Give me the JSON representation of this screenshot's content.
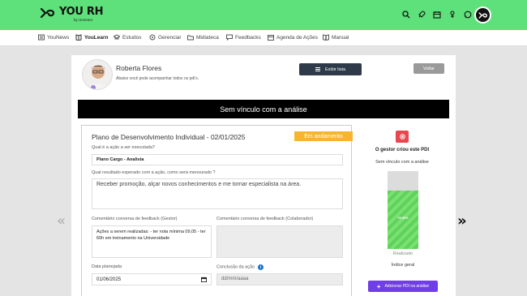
{
  "brand": {
    "name": "YOU RH",
    "sub": "by Umentor"
  },
  "colors": {
    "topbar": "#5ee07a",
    "accent_purple": "#6f3ee8",
    "badge_yellow": "#f5b531",
    "stop_red": "#e7474f"
  },
  "top_icons": [
    "search-icon",
    "rocket-icon",
    "calendar-icon",
    "hourglass-icon",
    "chat-icon"
  ],
  "nav": {
    "items": [
      {
        "label": "YouNews",
        "icon": "news-icon"
      },
      {
        "label": "YouLearn",
        "icon": "book-icon",
        "active": true
      },
      {
        "label": "Estudos",
        "icon": "graduation-icon"
      },
      {
        "label": "Gerenciar",
        "icon": "gear-icon"
      },
      {
        "label": "Midiateca",
        "icon": "folder-icon"
      },
      {
        "label": "Feedbacks",
        "icon": "chat-icon"
      },
      {
        "label": "Agenda de Ações",
        "icon": "calendar-icon"
      },
      {
        "label": "Manual",
        "icon": "manual-icon"
      }
    ]
  },
  "profile": {
    "name": "Roberta Flores",
    "subtitle": "Abaixo você pode acompanhar todos os pdi's."
  },
  "buttons": {
    "list": "Exibir lista",
    "back": "Voltar",
    "add": "Adicionar PDI na análise"
  },
  "banner": "Sem vínculo com a análise",
  "plan": {
    "title": "Plano de Desenvolvimento Individual - 02/01/2025",
    "status": "Em andamento",
    "q_action": "Qual é a ação a ser executada?",
    "action_value": "Plano Cargo - Analista",
    "q_result": "Qual resultado esperado com a ação, como será mensurado ?",
    "result_value": "Receber promoção, alçar novos conhecimentos e me tornar especialista na área.",
    "lbl_feedback_manager": "Comentário conversa de feedback (Gestor)",
    "feedback_manager_value": "Ações a serem realizadas:  - ter nota mínima 09,05 - ter 60h em treinamento na Universidade",
    "lbl_feedback_collab": "Comentário conversa de feedback (Colaborador)",
    "feedback_collab_value": "",
    "lbl_planned_date": "Data planejada",
    "planned_date_value": "01/06/2025",
    "lbl_conclusion": "Conclusão da ação",
    "conclusion_placeholder": "dd/mm/aaaa"
  },
  "stats": {
    "title": "O gestor criou este PDI",
    "subtitle": "Sem vínculo com a análise",
    "percent": 75,
    "percent_label": "75.00%",
    "realizado": "Realizado",
    "indice": "Índice geral"
  },
  "arrows": {
    "left": "«",
    "right": "»"
  }
}
